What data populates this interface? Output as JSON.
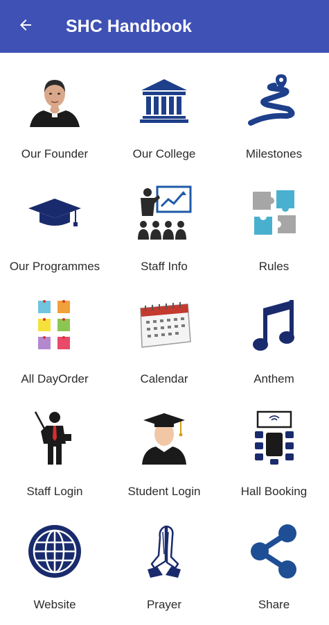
{
  "app_bar": {
    "title": "SHC Handbook",
    "back_icon": "arrow-back-icon",
    "color": "#3f51b5"
  },
  "menu": {
    "items": [
      {
        "label": "Our Founder",
        "icon": "founder-portrait-icon"
      },
      {
        "label": "Our College",
        "icon": "college-building-icon"
      },
      {
        "label": "Milestones",
        "icon": "milestone-path-icon"
      },
      {
        "label": "Our Programmes",
        "icon": "graduation-cap-icon"
      },
      {
        "label": "Staff Info",
        "icon": "presentation-icon"
      },
      {
        "label": "Rules",
        "icon": "puzzle-icon"
      },
      {
        "label": "All DayOrder",
        "icon": "sticky-notes-icon"
      },
      {
        "label": "Calendar",
        "icon": "calendar-icon"
      },
      {
        "label": "Anthem",
        "icon": "music-note-icon"
      },
      {
        "label": "Staff Login",
        "icon": "teacher-icon"
      },
      {
        "label": "Student Login",
        "icon": "student-icon"
      },
      {
        "label": "Hall Booking",
        "icon": "conference-hall-icon"
      },
      {
        "label": "Website",
        "icon": "globe-icon"
      },
      {
        "label": "Prayer",
        "icon": "praying-hands-icon"
      },
      {
        "label": "Share",
        "icon": "share-icon"
      }
    ]
  },
  "colors": {
    "primary": "#3f51b5",
    "icon_navy": "#1a2b6d",
    "label_text": "#2b2b2b"
  }
}
